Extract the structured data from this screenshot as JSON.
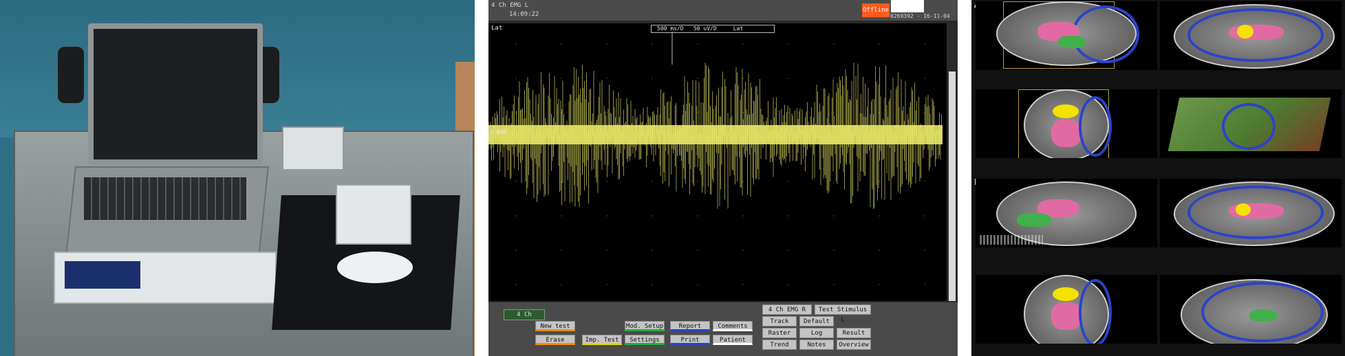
{
  "emg": {
    "header": {
      "title": "4 Ch EMG L",
      "time": "14:09:22",
      "status": "Offline",
      "id_date": "0269392 - 16-11-04"
    },
    "trace": {
      "channel_label": "Lat",
      "baseline_value": "0.000",
      "timebase": "500 ms/D",
      "gain": "50 uV/D",
      "scale_channel": "Lat"
    },
    "channel_tag": "4 Ch",
    "buttons": {
      "new_test": "New test",
      "erase": "Erase",
      "imp_test": "Imp. Test",
      "mod_setup": "Mod. Setup",
      "settings": "Settings",
      "report": "Report",
      "print": "Print",
      "comments": "Comments",
      "patient": "Patient",
      "emg_r": "4 Ch EMG R",
      "test_stimulus": "Test Stimulus L",
      "track": "Track",
      "default": "Default",
      "raster": "Raster",
      "log": "Log",
      "result": "Result",
      "trend": "Trend",
      "notes": "Notes",
      "overview": "Overview"
    },
    "colors": {
      "signal": "#f2f06a",
      "offline": "#ff5a1f"
    }
  },
  "mri": {
    "panel_labels": [
      "A",
      "B"
    ]
  }
}
